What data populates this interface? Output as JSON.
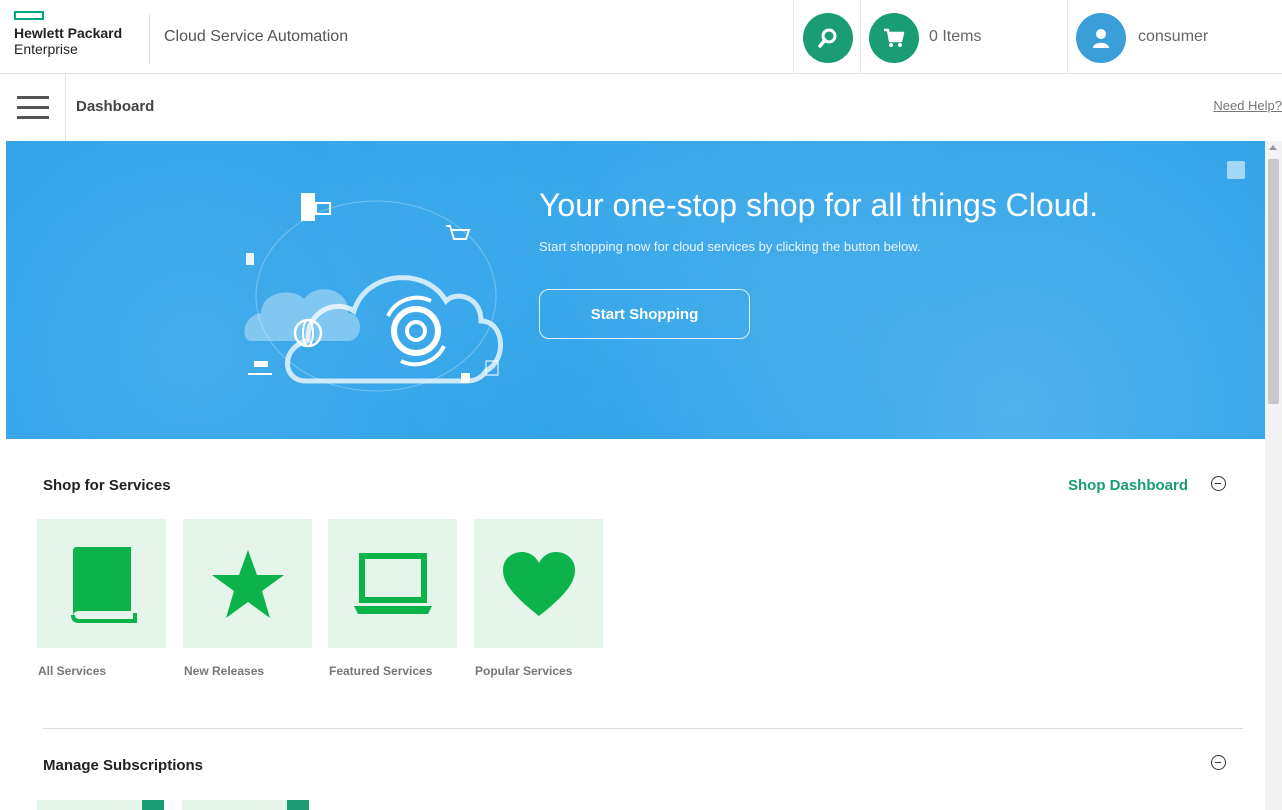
{
  "header": {
    "brand_line1": "Hewlett Packard",
    "brand_line2": "Enterprise",
    "app_title": "Cloud Service Automation",
    "cart_label": "0 Items",
    "user_label": "consumer",
    "search_icon": "search-icon",
    "cart_icon": "cart-icon",
    "user_icon": "user-icon"
  },
  "nav": {
    "page_title": "Dashboard",
    "help_link": "Need Help?"
  },
  "hero": {
    "headline": "Your one-stop shop for all things Cloud.",
    "subtext": "Start shopping now for cloud services by clicking the button below.",
    "button_label": "Start Shopping"
  },
  "shop": {
    "title": "Shop for Services",
    "dashboard_link": "Shop Dashboard",
    "tiles": [
      {
        "label": "All Services",
        "icon": "book-icon"
      },
      {
        "label": "New Releases",
        "icon": "star-icon"
      },
      {
        "label": "Featured Services",
        "icon": "laptop-icon"
      },
      {
        "label": "Popular Services",
        "icon": "heart-icon"
      }
    ]
  },
  "subscriptions": {
    "title": "Manage Subscriptions"
  },
  "colors": {
    "accent_green": "#1a9c74",
    "tile_green": "#0bb34a",
    "hero_blue": "#2aa1e8",
    "avatar_blue": "#3a9fd8"
  }
}
